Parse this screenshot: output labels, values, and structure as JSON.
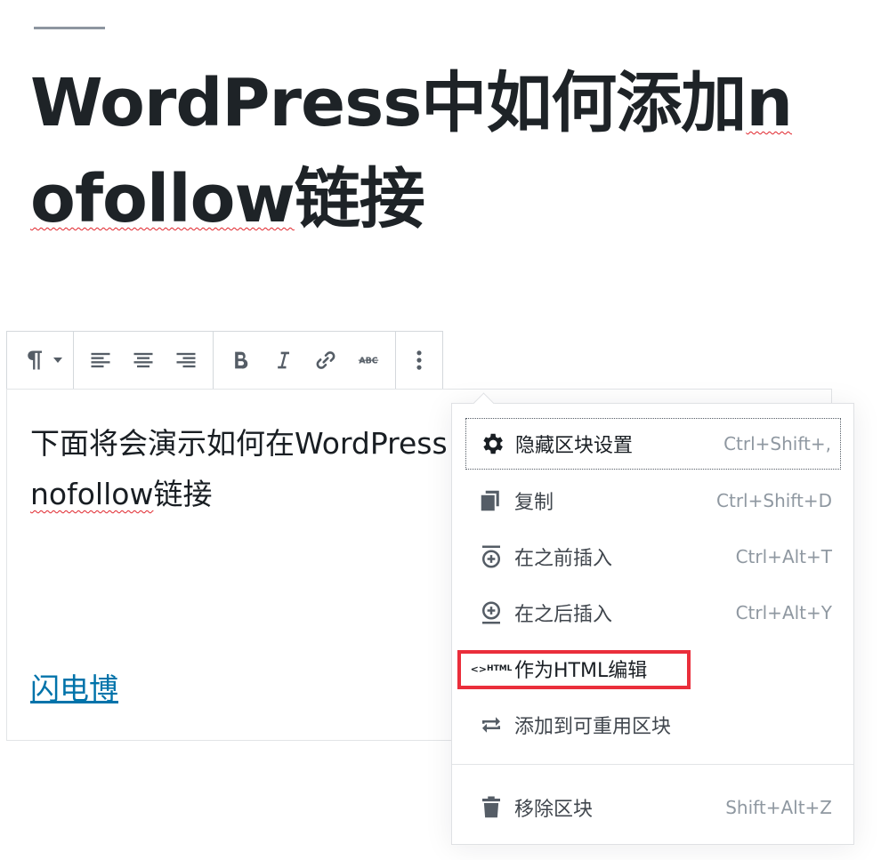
{
  "post": {
    "title_part1": "WordPress中如何添加",
    "title_part2": "n",
    "title_part3": "ofollow",
    "title_part4": "链接"
  },
  "block": {
    "text_line1": "下面将会演示如何在WordPress中添加",
    "text_word": "nofollow",
    "text_tail": "链接",
    "link": "闪电博"
  },
  "toolbar": {
    "icons": [
      "paragraph-icon",
      "align-left-icon",
      "align-center-icon",
      "align-right-icon",
      "bold-icon",
      "italic-icon",
      "link-icon",
      "strikethrough-icon",
      "more-vertical-icon"
    ],
    "strike_label": "ABC"
  },
  "menu": {
    "items": [
      {
        "label": "隐藏区块设置",
        "shortcut": "Ctrl+Shift+,",
        "icon": "gear-icon"
      },
      {
        "label": "复制",
        "shortcut": "Ctrl+Shift+D",
        "icon": "duplicate-icon"
      },
      {
        "label": "在之前插入",
        "shortcut": "Ctrl+Alt+T",
        "icon": "insert-before-icon"
      },
      {
        "label": "在之后插入",
        "shortcut": "Ctrl+Alt+Y",
        "icon": "insert-after-icon"
      },
      {
        "label": "作为HTML编辑",
        "shortcut": "",
        "icon": "html-icon",
        "icon_text": "HTML"
      },
      {
        "label": "添加到可重用区块",
        "shortcut": "",
        "icon": "reusable-icon"
      },
      {
        "label": "移除区块",
        "shortcut": "Shift+Alt+Z",
        "icon": "trash-icon"
      }
    ]
  },
  "colors": {
    "accent_link": "#0073aa",
    "highlight": "#ea2e3b",
    "spellcheck": "#e0242b"
  }
}
